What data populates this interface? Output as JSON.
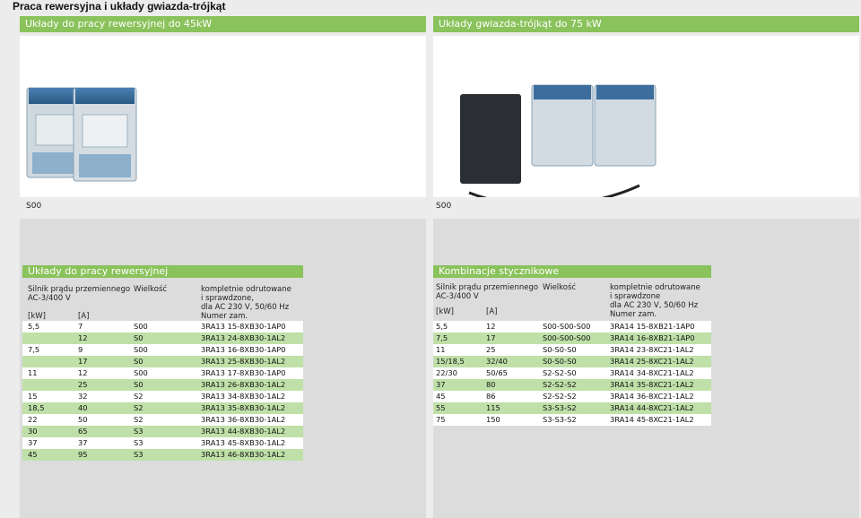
{
  "page_title": "Praca rewersyjna i układy gwiazda-trójkąt",
  "sections": {
    "left_bar": "Układy do pracy rewersyjnej do 45kW",
    "right_bar": "Układy gwiazda-trójkąt do 75 kW",
    "left_photo_label": "S00",
    "right_photo_label": "S00"
  },
  "left_table": {
    "title": "Układy do pracy rewersyjnej",
    "headers": {
      "motor": "Silnik prądu przemiennego",
      "motor_sub": "AC-3/400 V",
      "kw": "[kW]",
      "a": "[A]",
      "size": "Wielkość",
      "desc1": "kompletnie odrutowane",
      "desc2": "i sprawdzone,",
      "desc3": "dla AC 230 V, 50/60 Hz",
      "desc4": "Numer zam."
    },
    "rows": [
      {
        "kw": "5,5",
        "a": "7",
        "size": "S00",
        "order": "3RA13 15-8XB30-1AP0",
        "shade": "w"
      },
      {
        "kw": "",
        "a": "12",
        "size": "S0",
        "order": "3RA13 24-8XB30-1AL2",
        "shade": "g"
      },
      {
        "kw": "7,5",
        "a": "9",
        "size": "S00",
        "order": "3RA13 16-8XB30-1AP0",
        "shade": "w"
      },
      {
        "kw": "",
        "a": "17",
        "size": "S0",
        "order": "3RA13 25-8XB30-1AL2",
        "shade": "g"
      },
      {
        "kw": "11",
        "a": "12",
        "size": "S00",
        "order": "3RA13 17-8XB30-1AP0",
        "shade": "w"
      },
      {
        "kw": "",
        "a": "25",
        "size": "S0",
        "order": "3RA13 26-8XB30-1AL2",
        "shade": "g"
      },
      {
        "kw": "15",
        "a": "32",
        "size": "S2",
        "order": "3RA13 34-8XB30-1AL2",
        "shade": "w"
      },
      {
        "kw": "18,5",
        "a": "40",
        "size": "S2",
        "order": "3RA13 35-8XB30-1AL2",
        "shade": "g"
      },
      {
        "kw": "22",
        "a": "50",
        "size": "S2",
        "order": "3RA13 36-8XB30-1AL2",
        "shade": "w"
      },
      {
        "kw": "30",
        "a": "65",
        "size": "S3",
        "order": "3RA13 44-8XB30-1AL2",
        "shade": "g"
      },
      {
        "kw": "37",
        "a": "37",
        "size": "S3",
        "order": "3RA13 45-8XB30-1AL2",
        "shade": "w"
      },
      {
        "kw": "45",
        "a": "95",
        "size": "S3",
        "order": "3RA13 46-8XB30-1AL2",
        "shade": "g"
      }
    ]
  },
  "right_table": {
    "title": "Kombinacje stycznikowe",
    "headers": {
      "motor": "Silnik prądu przemiennego",
      "motor_sub": "AC-3/400 V",
      "kw": "[kW]",
      "a": "[A]",
      "size": "Wielkość",
      "desc1": "kompletnie odrutowane",
      "desc2": "i sprawdzone",
      "desc3": "dla AC 230 V, 50/60 Hz",
      "desc4": "Numer zam."
    },
    "rows": [
      {
        "kw": "5,5",
        "a": "12",
        "size": "S00-S00-S00",
        "order": "3RA14 15-8XB21-1AP0",
        "shade": "w"
      },
      {
        "kw": "7,5",
        "a": "17",
        "size": "S00-S00-S00",
        "order": "3RA14 16-8XB21-1AP0",
        "shade": "g"
      },
      {
        "kw": "11",
        "a": "25",
        "size": "S0-S0-S0",
        "order": "3RA14 23-8XC21-1AL2",
        "shade": "w"
      },
      {
        "kw": "15/18,5",
        "a": "32/40",
        "size": "S0-S0-S0",
        "order": "3RA14 25-8XC21-1AL2",
        "shade": "g"
      },
      {
        "kw": "22/30",
        "a": "50/65",
        "size": "S2-S2-S0",
        "order": "3RA14 34-8XC21-1AL2",
        "shade": "w"
      },
      {
        "kw": "37",
        "a": "80",
        "size": "S2-S2-S2",
        "order": "3RA14 35-8XC21-1AL2",
        "shade": "g"
      },
      {
        "kw": "45",
        "a": "86",
        "size": "S2-S2-S2",
        "order": "3RA14 36-8XC21-1AL2",
        "shade": "w"
      },
      {
        "kw": "55",
        "a": "115",
        "size": "S3-S3-S2",
        "order": "3RA14 44-8XC21-1AL2",
        "shade": "g"
      },
      {
        "kw": "75",
        "a": "150",
        "size": "S3-S3-S2",
        "order": "3RA14 45-8XC21-1AL2",
        "shade": "w"
      }
    ]
  },
  "colors": {
    "accent": "#8ac25b",
    "row_green": "#bfe0a8",
    "background": "#ececec"
  }
}
